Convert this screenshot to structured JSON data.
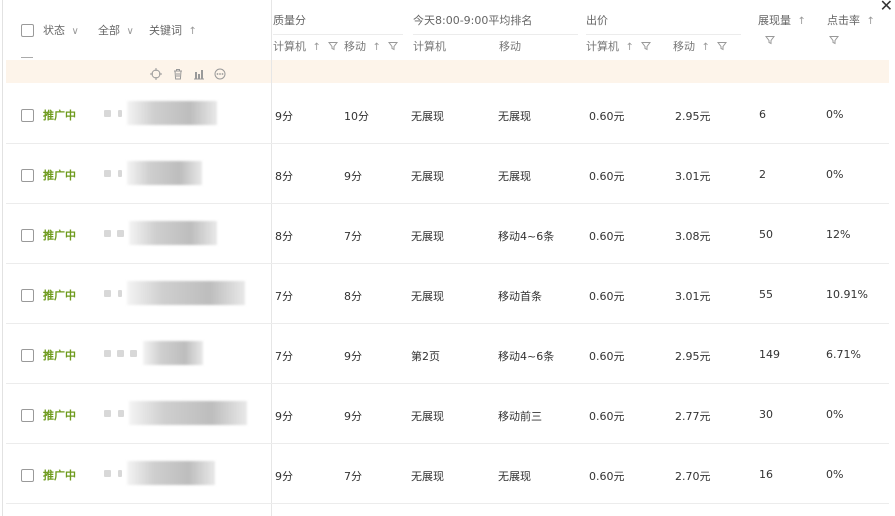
{
  "window": {
    "close_label": "✕"
  },
  "header": {
    "status": "状态",
    "all": "全部",
    "keyword": "关键词",
    "quality_score": "质量分",
    "rank_today": "今天8:00-9:00平均排名",
    "bid": "出价",
    "impressions": "展现量",
    "ctr": "点击率",
    "sub_pc": "计算机",
    "sub_mobile": "移动",
    "sub_pc_rank": "计算机",
    "sub_mobile_rank": "移动",
    "sub_pc_bid": "计算机",
    "sub_mobile_bid": "移动"
  },
  "toolbar": {
    "locate_icon": "crosshair-icon",
    "delete_icon": "trash-icon",
    "chart_icon": "bar-chart-icon",
    "more_icon": "more-icon"
  },
  "rows": [
    {
      "status": "推广中",
      "pc_score": "9分",
      "mobile_score": "10分",
      "pc_rank": "无展现",
      "mobile_rank": "无展现",
      "pc_bid": "0.60元",
      "mobile_bid": "2.95元",
      "impressions": "6",
      "ctr": "0%"
    },
    {
      "status": "推广中",
      "pc_score": "8分",
      "mobile_score": "9分",
      "pc_rank": "无展现",
      "mobile_rank": "无展现",
      "pc_bid": "0.60元",
      "mobile_bid": "3.01元",
      "impressions": "2",
      "ctr": "0%"
    },
    {
      "status": "推广中",
      "pc_score": "8分",
      "mobile_score": "7分",
      "pc_rank": "无展现",
      "mobile_rank": "移动4~6条",
      "pc_bid": "0.60元",
      "mobile_bid": "3.08元",
      "impressions": "50",
      "ctr": "12%"
    },
    {
      "status": "推广中",
      "pc_score": "7分",
      "mobile_score": "8分",
      "pc_rank": "无展现",
      "mobile_rank": "移动首条",
      "pc_bid": "0.60元",
      "mobile_bid": "3.01元",
      "impressions": "55",
      "ctr": "10.91%"
    },
    {
      "status": "推广中",
      "pc_score": "7分",
      "mobile_score": "9分",
      "pc_rank": "第2页",
      "mobile_rank": "移动4~6条",
      "pc_bid": "0.60元",
      "mobile_bid": "2.95元",
      "impressions": "149",
      "ctr": "6.71%"
    },
    {
      "status": "推广中",
      "pc_score": "9分",
      "mobile_score": "9分",
      "pc_rank": "无展现",
      "mobile_rank": "移动前三",
      "pc_bid": "0.60元",
      "mobile_bid": "2.77元",
      "impressions": "30",
      "ctr": "0%"
    },
    {
      "status": "推广中",
      "pc_score": "9分",
      "mobile_score": "7分",
      "pc_rank": "无展现",
      "mobile_rank": "无展现",
      "pc_bid": "0.60元",
      "mobile_bid": "2.70元",
      "impressions": "16",
      "ctr": "0%"
    }
  ],
  "colors": {
    "status_green": "#6f9b1e",
    "toolbar_bg": "#fdf4ea",
    "border": "#e6e6e6"
  }
}
